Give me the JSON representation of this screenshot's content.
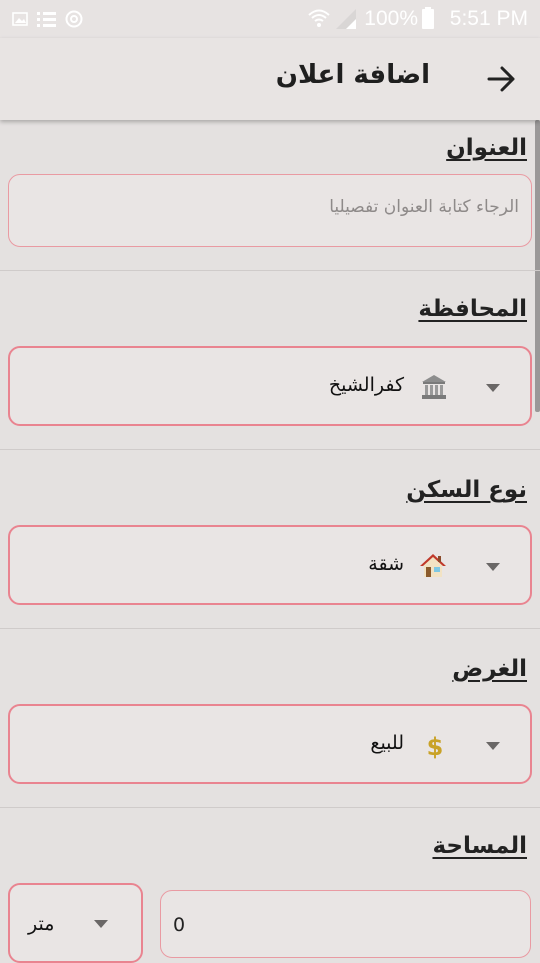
{
  "status_bar": {
    "battery": "100%",
    "time": "5:51 PM",
    "icons": [
      "image-icon",
      "list-icon",
      "sync-icon",
      "wifi-icon",
      "signal-icon",
      "battery-icon"
    ]
  },
  "app_bar": {
    "title": "اضافة اعلان",
    "back_icon": "arrow-right-icon"
  },
  "form": {
    "title_label": "العنوان",
    "title_placeholder": "الرجاء كتابة العنوان تفصيليا",
    "governorate_label": "المحافظة",
    "governorate_value": "كفرالشيخ",
    "governorate_icon": "bank-icon",
    "housing_type_label": "نوع السكن",
    "housing_type_value": "شقة",
    "housing_type_icon": "house-icon",
    "purpose_label": "الغرض",
    "purpose_value": "للبيع",
    "purpose_icon": "dollar-icon",
    "area_label": "المساحة",
    "area_value": "0",
    "area_unit": "متر"
  },
  "colors": {
    "field_border": "#e98490",
    "background": "#e4e1e0",
    "app_bar": "#e8e4e3"
  }
}
